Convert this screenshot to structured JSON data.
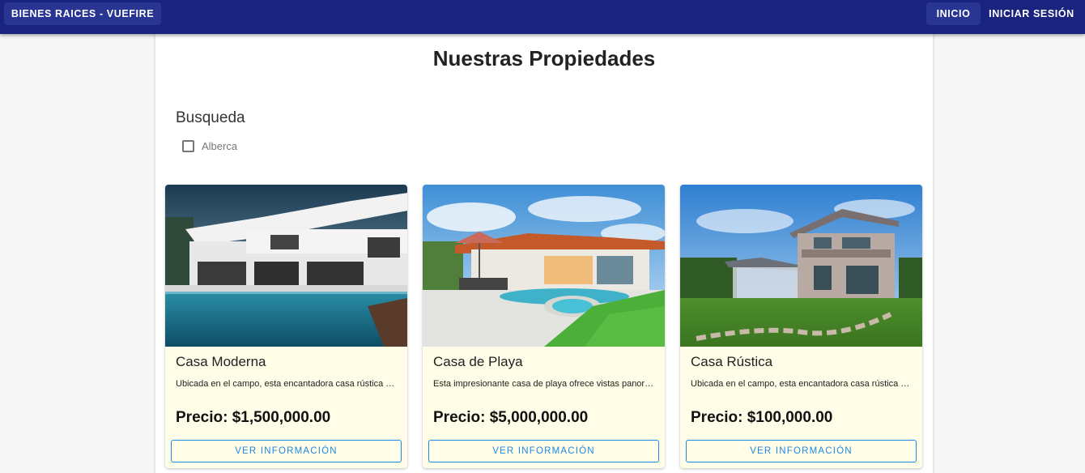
{
  "appbar": {
    "brand": "BIENES RAICES - VUEFIRE",
    "nav": [
      {
        "label": "INICIO"
      },
      {
        "label": "INICIAR SESIÓN"
      }
    ]
  },
  "main": {
    "title": "Nuestras Propiedades",
    "search": {
      "title": "Busqueda",
      "filters": [
        {
          "label": "Alberca",
          "checked": false
        }
      ]
    },
    "properties": [
      {
        "title": "Casa Moderna",
        "description": "Ubicada en el campo, esta encantadora casa rústica ofrece un ambiente acogedor",
        "price": "Precio: $1,500,000.00",
        "button": "VER INFORMACIÓN",
        "image": "modern-house-with-pool"
      },
      {
        "title": "Casa de Playa",
        "description": "Esta impresionante casa de playa ofrece vistas panorámicas al océano",
        "price": "Precio: $5,000,000.00",
        "button": "VER INFORMACIÓN",
        "image": "beach-house-with-pool"
      },
      {
        "title": "Casa Rústica",
        "description": "Ubicada en el campo, esta encantadora casa rústica ofrece un ambiente acogedor",
        "price": "Precio: $100,000.00",
        "button": "VER INFORMACIÓN",
        "image": "rustic-two-story-house"
      }
    ]
  },
  "colors": {
    "appbar": "#1a237e",
    "card_background": "#fffde7",
    "button_accent": "#1e88e5"
  }
}
